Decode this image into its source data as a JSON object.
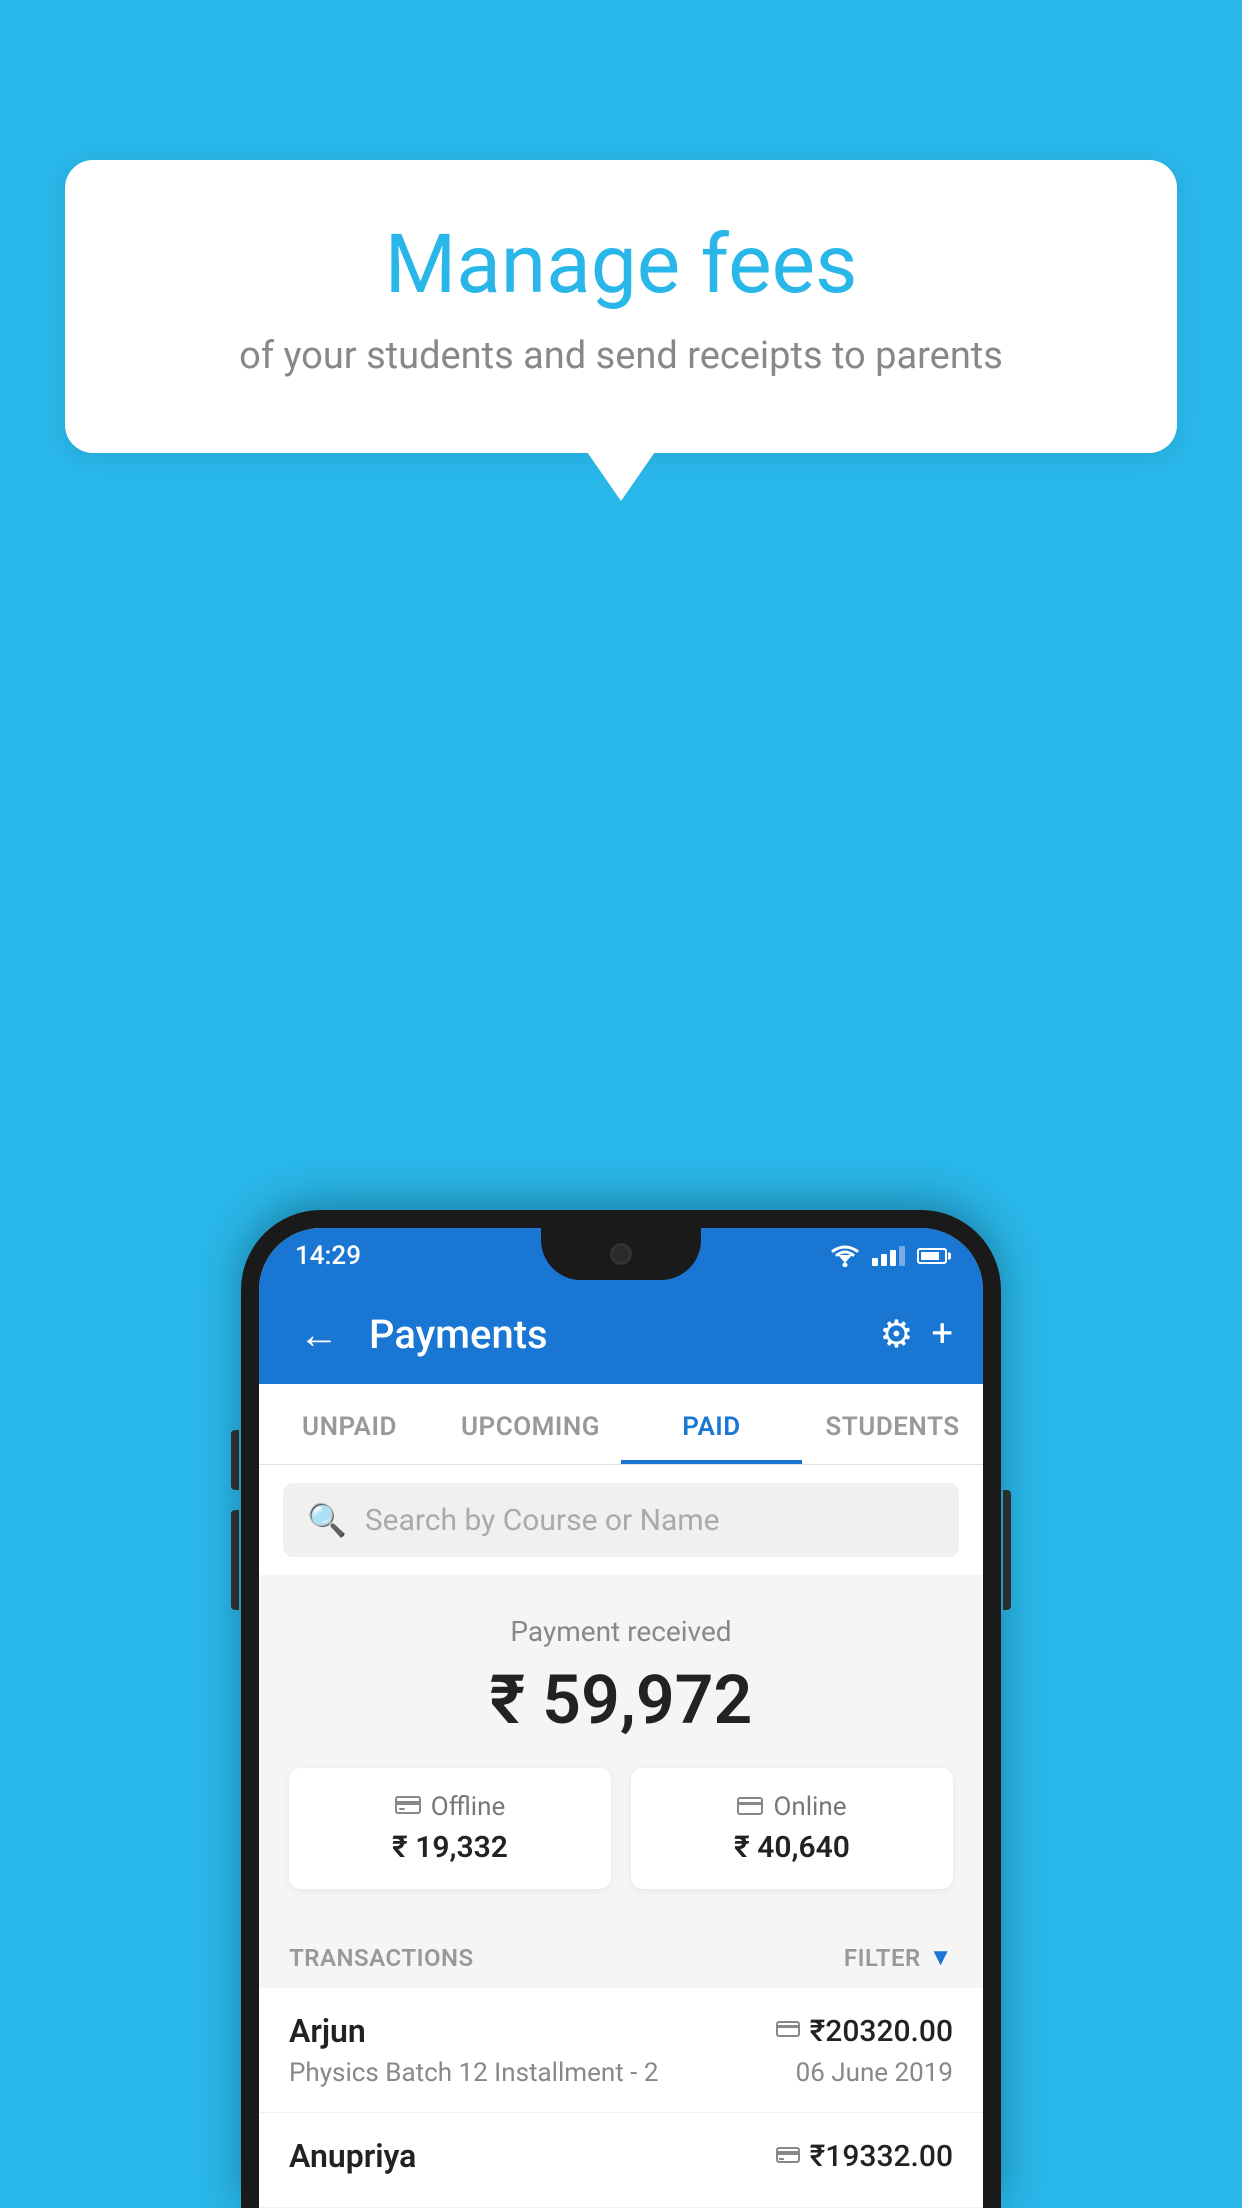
{
  "page": {
    "background_color": "#29B6E8"
  },
  "speech_bubble": {
    "title": "Manage fees",
    "subtitle": "of your students and send receipts to parents"
  },
  "status_bar": {
    "time": "14:29"
  },
  "app_bar": {
    "title": "Payments",
    "back_label": "←",
    "settings_label": "⚙",
    "add_label": "+"
  },
  "tabs": [
    {
      "label": "UNPAID",
      "active": false
    },
    {
      "label": "UPCOMING",
      "active": false
    },
    {
      "label": "PAID",
      "active": true
    },
    {
      "label": "STUDENTS",
      "active": false
    }
  ],
  "search": {
    "placeholder": "Search by Course or Name"
  },
  "payment_summary": {
    "label": "Payment received",
    "total_amount": "₹ 59,972",
    "offline": {
      "type": "Offline",
      "amount": "₹ 19,332"
    },
    "online": {
      "type": "Online",
      "amount": "₹ 40,640"
    }
  },
  "transactions": {
    "header_label": "TRANSACTIONS",
    "filter_label": "FILTER",
    "rows": [
      {
        "name": "Arjun",
        "course": "Physics Batch 12 Installment - 2",
        "amount": "₹20320.00",
        "date": "06 June 2019",
        "payment_type": "card"
      },
      {
        "name": "Anupriya",
        "course": "",
        "amount": "₹19332.00",
        "date": "",
        "payment_type": "offline"
      }
    ]
  }
}
